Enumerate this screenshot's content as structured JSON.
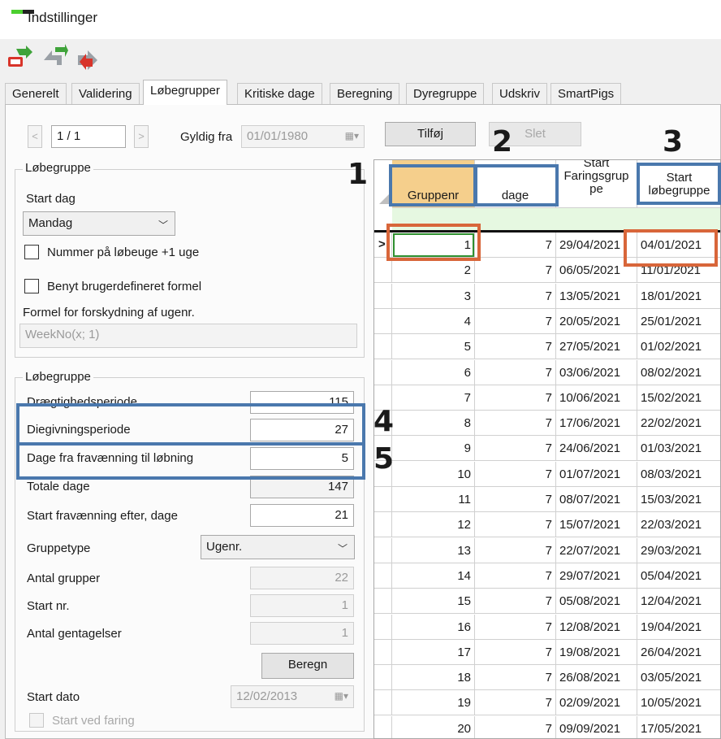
{
  "window": {
    "title": "Indstillinger"
  },
  "toolbar": {
    "buttons": [
      "save-icon",
      "undo-icon",
      "redo-icon"
    ]
  },
  "tabs": [
    "Generelt",
    "Validering",
    "Løbegrupper",
    "Kritiske dage",
    "Beregning",
    "Dyregruppe",
    "Udskriv",
    "SmartPigs"
  ],
  "nav": {
    "prev": "<",
    "counter": "1 / 1",
    "next": ">",
    "valid_from_label": "Gyldig fra",
    "valid_from_value": "01/01/1980",
    "add_label": "Tilføj",
    "delete_label": "Slet"
  },
  "group1": {
    "title": "Løbegruppe",
    "start_day_label": "Start dag",
    "start_day_value": "Mandag",
    "check1_label": "Nummer på løbeuge +1 uge",
    "check2_label": "Benyt brugerdefineret formel",
    "formula_label": "Formel for forskydning af ugenr.",
    "formula_value": "WeekNo(x; 1)"
  },
  "group2": {
    "title": "Løbegruppe",
    "fields": [
      {
        "label": "Drægtighedsperiode",
        "value": "115"
      },
      {
        "label": "Diegivningsperiode",
        "value": "27"
      },
      {
        "label": "Dage fra fravænning til løbning",
        "value": "5"
      },
      {
        "label": "Totale dage",
        "value": "147"
      },
      {
        "label": "Start fravænning efter, dage",
        "value": "21"
      }
    ],
    "group_type_label": "Gruppetype",
    "group_type_value": "Ugenr.",
    "num_groups_label": "Antal grupper",
    "num_groups_value": "22",
    "start_nr_label": "Start nr.",
    "start_nr_value": "1",
    "repeat_label": "Antal gentagelser",
    "repeat_value": "1",
    "calc_label": "Beregn",
    "start_date_label": "Start dato",
    "start_date_value": "12/02/2013",
    "start_farrow_label": "Start ved faring"
  },
  "grid": {
    "headers": [
      "Gruppenr",
      "dage",
      "Start Faringsgruppe",
      "Start løbegruppe"
    ],
    "header3_lines": [
      "Start",
      "Faringsgrup",
      "pe"
    ],
    "header4_lines": [
      "Start",
      "løbegruppe"
    ],
    "current_row_marker": ">",
    "rows": [
      [
        "1",
        "7",
        "29/04/2021",
        "04/01/2021"
      ],
      [
        "2",
        "7",
        "06/05/2021",
        "11/01/2021"
      ],
      [
        "3",
        "7",
        "13/05/2021",
        "18/01/2021"
      ],
      [
        "4",
        "7",
        "20/05/2021",
        "25/01/2021"
      ],
      [
        "5",
        "7",
        "27/05/2021",
        "01/02/2021"
      ],
      [
        "6",
        "7",
        "03/06/2021",
        "08/02/2021"
      ],
      [
        "7",
        "7",
        "10/06/2021",
        "15/02/2021"
      ],
      [
        "8",
        "7",
        "17/06/2021",
        "22/02/2021"
      ],
      [
        "9",
        "7",
        "24/06/2021",
        "01/03/2021"
      ],
      [
        "10",
        "7",
        "01/07/2021",
        "08/03/2021"
      ],
      [
        "11",
        "7",
        "08/07/2021",
        "15/03/2021"
      ],
      [
        "12",
        "7",
        "15/07/2021",
        "22/03/2021"
      ],
      [
        "13",
        "7",
        "22/07/2021",
        "29/03/2021"
      ],
      [
        "14",
        "7",
        "29/07/2021",
        "05/04/2021"
      ],
      [
        "15",
        "7",
        "05/08/2021",
        "12/04/2021"
      ],
      [
        "16",
        "7",
        "12/08/2021",
        "19/04/2021"
      ],
      [
        "17",
        "7",
        "19/08/2021",
        "26/04/2021"
      ],
      [
        "18",
        "7",
        "26/08/2021",
        "03/05/2021"
      ],
      [
        "19",
        "7",
        "02/09/2021",
        "10/05/2021"
      ],
      [
        "20",
        "7",
        "09/09/2021",
        "17/05/2021"
      ]
    ]
  },
  "annotations": [
    "1",
    "2",
    "3",
    "4",
    "5"
  ],
  "colors": {
    "annotation_blue": "#4a78ad",
    "annotation_red": "#d8663a",
    "header_orange": "#f5cf8c",
    "filter_green": "#e6f8e1"
  }
}
